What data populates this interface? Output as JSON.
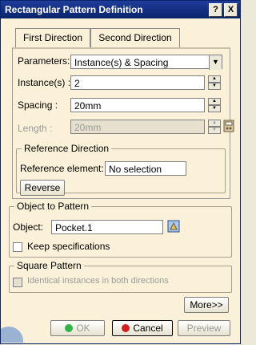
{
  "window": {
    "title": "Rectangular Pattern Definition",
    "help_btn": "?",
    "close_btn": "X"
  },
  "tabs": [
    {
      "label": "First Direction"
    },
    {
      "label": "Second Direction"
    }
  ],
  "parameters": {
    "label": "Parameters:",
    "value": "Instance(s) & Spacing"
  },
  "instances": {
    "label": "Instance(s) :",
    "value": "2"
  },
  "spacing": {
    "label": "Spacing :",
    "value": "20mm"
  },
  "length": {
    "label": "Length :",
    "value": "20mm"
  },
  "reference_direction": {
    "title": "Reference Direction",
    "element_label": "Reference element:",
    "element_value": "No selection",
    "reverse_label": "Reverse"
  },
  "object_to_pattern": {
    "title": "Object to Pattern",
    "object_label": "Object:",
    "object_value": "Pocket.1",
    "keep_specs_label": "Keep specifications"
  },
  "square_pattern": {
    "title": "Square Pattern",
    "identical_label": "Identical instances in both directions"
  },
  "buttons": {
    "more": "More>>",
    "ok": "OK",
    "cancel": "Cancel",
    "preview": "Preview"
  },
  "colors": {
    "titlebar": "#0a246a",
    "dialog_bg": "#fbf1d8",
    "ok_icon": "#2fb44a",
    "cancel_icon": "#d21f1f"
  }
}
